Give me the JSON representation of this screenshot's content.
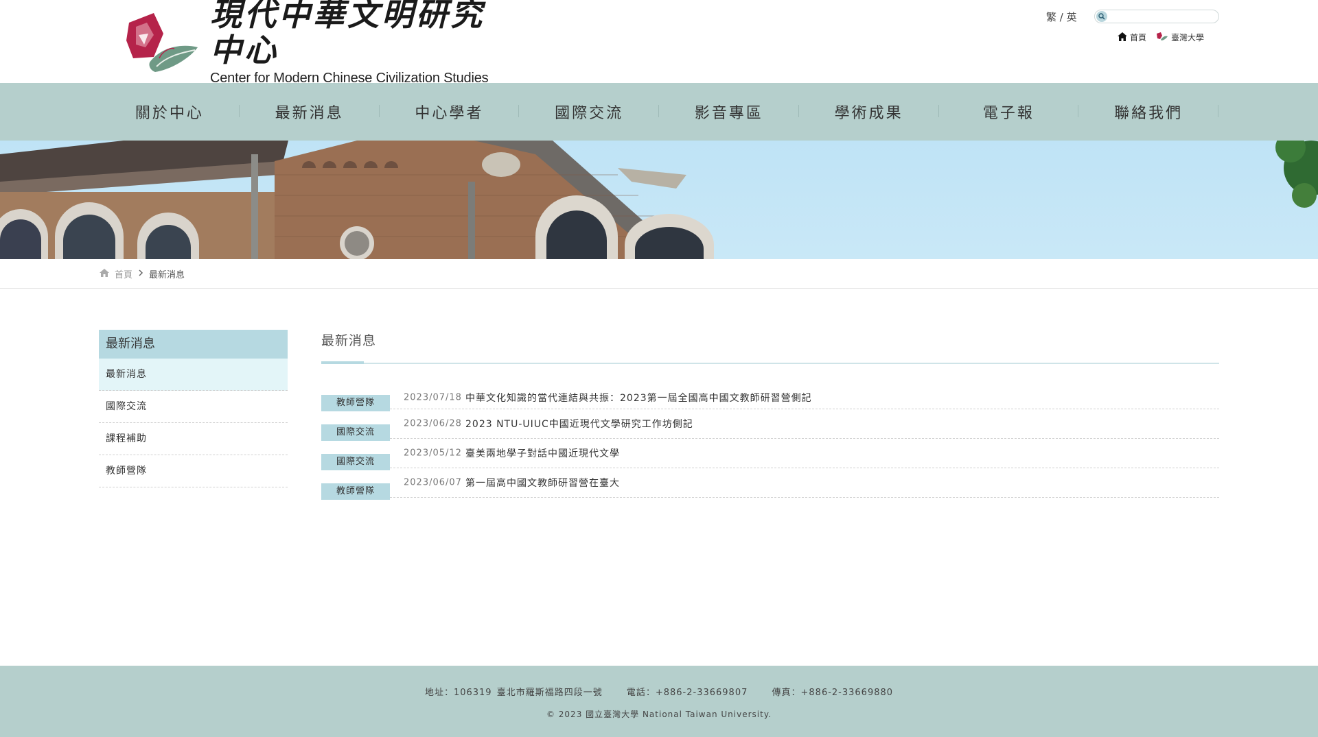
{
  "header": {
    "logo_cn": "現代中華文明研究中心",
    "logo_en": "Center for Modern Chinese Civilization Studies",
    "lang_trad": "繁",
    "lang_sep": "/",
    "lang_en": "英",
    "search_placeholder": "",
    "home_link": "首頁",
    "ntu_link": "臺灣大學"
  },
  "nav": {
    "items": [
      "關於中心",
      "最新消息",
      "中心學者",
      "國際交流",
      "影音專區",
      "學術成果",
      "電子報",
      "聯絡我們"
    ]
  },
  "breadcrumb": {
    "home": "首頁",
    "current": "最新消息"
  },
  "sidebar": {
    "title": "最新消息",
    "items": [
      "最新消息",
      "國際交流",
      "課程補助",
      "教師營隊"
    ]
  },
  "main": {
    "title": "最新消息",
    "news": [
      {
        "tag": "教師營隊",
        "date": "2023/07/18",
        "title": "中華文化知識的當代連結與共振：2023第一屆全國高中國文教師研習營側記"
      },
      {
        "tag": "國際交流",
        "date": "2023/06/28",
        "title": "2023 NTU-UIUC中國近現代文學研究工作坊側記"
      },
      {
        "tag": "國際交流",
        "date": "2023/05/12",
        "title": "臺美兩地學子對話中國近現代文學"
      },
      {
        "tag": "教師營隊",
        "date": "2023/06/07",
        "title": "第一屆高中國文教師研習營在臺大"
      }
    ]
  },
  "footer": {
    "address": "地址：106319 臺北市羅斯福路四段一號",
    "phone": "電話：+886-2-33669807",
    "fax": "傳真：+886-2-33669880",
    "copyright": "© 2023 國立臺灣大學 National Taiwan University."
  },
  "colors": {
    "nav_bg": "#b5cfcc",
    "accent": "#b6d9e1",
    "logo_red": "#b5234a"
  }
}
